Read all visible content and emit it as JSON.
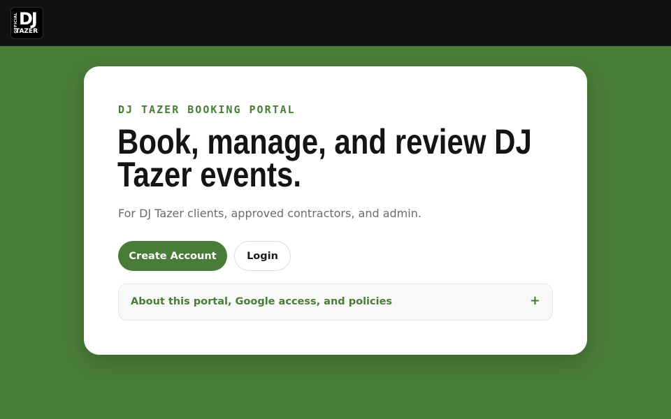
{
  "header": {
    "logo": {
      "official": "OFFICIAL",
      "dj": "DJ",
      "tazer": "TAZER"
    }
  },
  "card": {
    "eyebrow": "DJ TAZER BOOKING PORTAL",
    "headline": "Book, manage, and review DJ Tazer events.",
    "subtitle": "For DJ Tazer clients, approved contractors, and admin.",
    "create_account_label": "Create Account",
    "login_label": "Login",
    "disclosure_label": "About this portal, Google access, and policies",
    "disclosure_icon": "+"
  },
  "colors": {
    "background": "#4a7c39",
    "topbar": "#111111",
    "accent": "#4a7c39",
    "card": "#ffffff"
  }
}
